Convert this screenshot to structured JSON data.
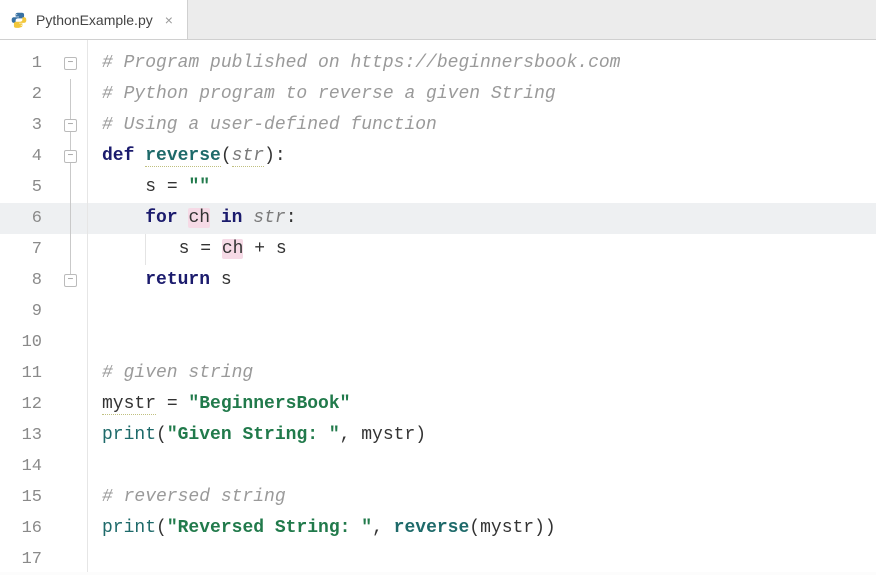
{
  "tab": {
    "filename": "PythonExample.py",
    "close_glyph": "×"
  },
  "editor": {
    "highlighted_line": 6,
    "line_count": 17,
    "lines": {
      "l1": {
        "comment": "# Program published on https://beginnersbook.com"
      },
      "l2": {
        "comment": "# Python program to reverse a given String"
      },
      "l3": {
        "comment": "# Using a user-defined function"
      },
      "l4": {
        "kw_def": "def",
        "fn_name": "reverse",
        "open": "(",
        "param": "str",
        "close": "):"
      },
      "l5": {
        "var": "s",
        "eq": " = ",
        "str": "\"\""
      },
      "l6": {
        "kw_for": "for",
        "ch": "ch",
        "kw_in": "in",
        "param": "str",
        "colon": ":"
      },
      "l7": {
        "var": "s",
        "eq": " = ",
        "ch": "ch",
        "plus": " + s"
      },
      "l8": {
        "kw_return": "return",
        "var": " s"
      },
      "l11": {
        "comment": "# given string"
      },
      "l12": {
        "var": "mystr",
        "eq": " = ",
        "str": "\"BeginnersBook\""
      },
      "l13": {
        "fn": "print",
        "open": "(",
        "str": "\"Given String: \"",
        "rest": ", mystr)"
      },
      "l15": {
        "comment": "# reversed string"
      },
      "l16": {
        "fn": "print",
        "open": "(",
        "str": "\"Reversed String: \"",
        "comma": ", ",
        "call": "reverse",
        "rest": "(mystr))"
      }
    }
  }
}
